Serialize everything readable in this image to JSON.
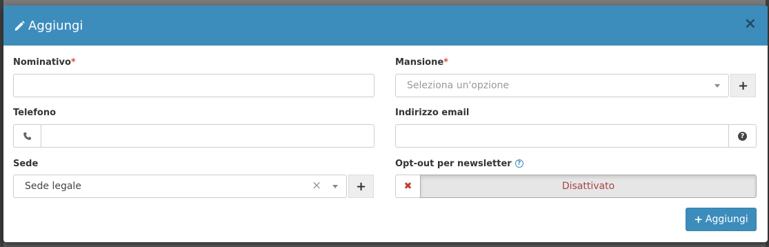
{
  "modal": {
    "title": "Aggiungi",
    "close_symbol": "×",
    "title_icon": "pencil-icon"
  },
  "form": {
    "nominativo": {
      "label": "Nominativo",
      "required_mark": "*",
      "value": ""
    },
    "mansione": {
      "label": "Mansione",
      "required_mark": "*",
      "placeholder": "Seleziona un'opzione",
      "add_symbol": "+"
    },
    "telefono": {
      "label": "Telefono",
      "icon": "phone-icon",
      "value": ""
    },
    "email": {
      "label": "Indirizzo email",
      "value": "",
      "help_symbol": "?"
    },
    "sede": {
      "label": "Sede",
      "selected": "Sede legale",
      "clear_symbol": "×",
      "add_symbol": "+"
    },
    "newsletter": {
      "label": "Opt-out per newsletter",
      "help_symbol": "?",
      "off_symbol": "✖",
      "state": "Disattivato"
    }
  },
  "actions": {
    "submit_plus": "+",
    "submit_label": "Aggiungi"
  },
  "colors": {
    "header": "#3c8dbc",
    "required": "#dd4b39",
    "danger": "#a94442"
  }
}
